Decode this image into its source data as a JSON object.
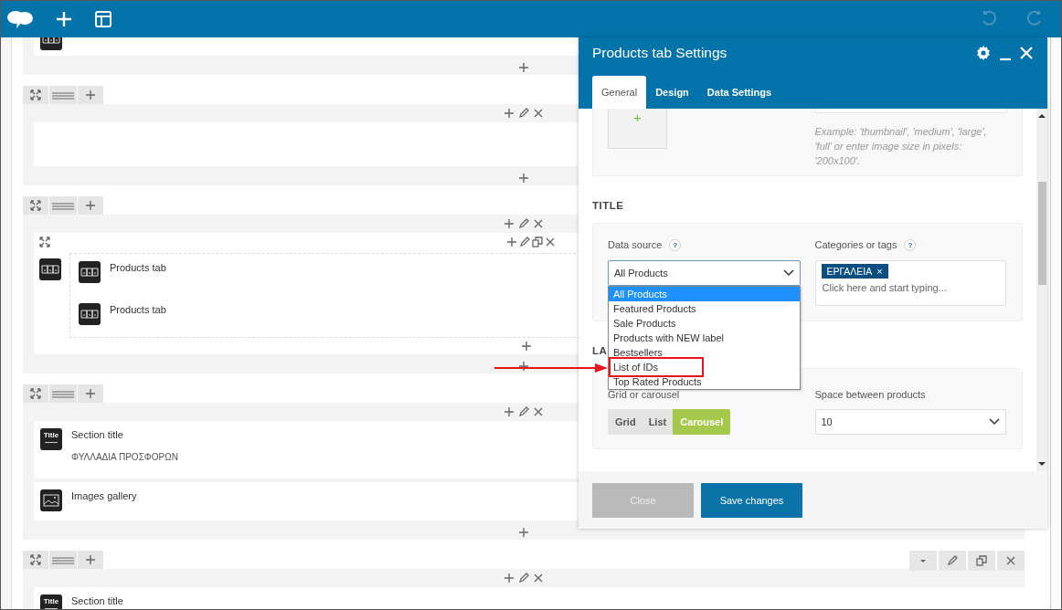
{
  "toolbar": {
    "history": [
      {
        "kind": "undo",
        "disabled": true
      },
      {
        "kind": "redo",
        "disabled": true
      }
    ]
  },
  "canvas": {
    "sections": [
      {
        "kind": "partial",
        "elements": [
          {
            "kind": "tabs"
          }
        ]
      },
      {
        "kind": "row"
      },
      {
        "kind": "nested",
        "elements": [
          {
            "kind": "tabs",
            "title": "Products tab"
          },
          {
            "kind": "tabs",
            "title": "Products tab"
          }
        ]
      },
      {
        "kind": "row",
        "elements": [
          {
            "kind": "title",
            "badge": "Title",
            "title": "Section title",
            "text": "ΦΥΛΛΑΔΙΑ ΠΡΟΣΦΟΡΩΝ"
          },
          {
            "kind": "gallery",
            "title": "Images gallery"
          }
        ]
      },
      {
        "kind": "row",
        "hovered": true,
        "elements": [
          {
            "kind": "title",
            "badge": "Title",
            "title": "Section title"
          }
        ]
      }
    ]
  },
  "modal": {
    "title": "Products tab Settings",
    "tabs": [
      {
        "label": "General",
        "selected": true
      },
      {
        "label": "Design",
        "selected": false
      },
      {
        "label": "Data Settings",
        "selected": false
      }
    ],
    "image_panel": {
      "add_label": "+",
      "hint": "Example: 'thumbnail', 'medium', 'large', 'full' or enter image size in pixels: '200x100'."
    },
    "title_heading": "TITLE",
    "data_source": {
      "label": "Data source",
      "help": "?",
      "value": "All Products",
      "expanded": true,
      "options": [
        {
          "label": "All Products",
          "selected": true,
          "highlighted": false
        },
        {
          "label": "Featured Products",
          "selected": false,
          "highlighted": false
        },
        {
          "label": "Sale Products",
          "selected": false,
          "highlighted": false
        },
        {
          "label": "Products with NEW label",
          "selected": false,
          "highlighted": false
        },
        {
          "label": "Bestsellers",
          "selected": false,
          "highlighted": false
        },
        {
          "label": "List of IDs",
          "selected": false,
          "highlighted": true
        },
        {
          "label": "Top Rated Products",
          "selected": false,
          "highlighted": false
        }
      ]
    },
    "categories": {
      "label": "Categories or tags",
      "help": "?",
      "tags": [
        {
          "label": "ΕΡΓΑΛΕΙΑ",
          "remove": "×"
        }
      ],
      "placeholder": "Click here and start typing..."
    },
    "layout_heading": "LA",
    "grid_or_carousel": {
      "label": "Grid or carousel",
      "options": [
        {
          "label": "Grid",
          "selected": false
        },
        {
          "label": "List",
          "selected": false
        },
        {
          "label": "Carousel",
          "selected": true
        }
      ]
    },
    "spacing": {
      "label": "Space between products",
      "value": "10"
    },
    "buttons": [
      {
        "label": "Close",
        "kind": "secondary"
      },
      {
        "label": "Save changes",
        "kind": "primary"
      }
    ]
  }
}
